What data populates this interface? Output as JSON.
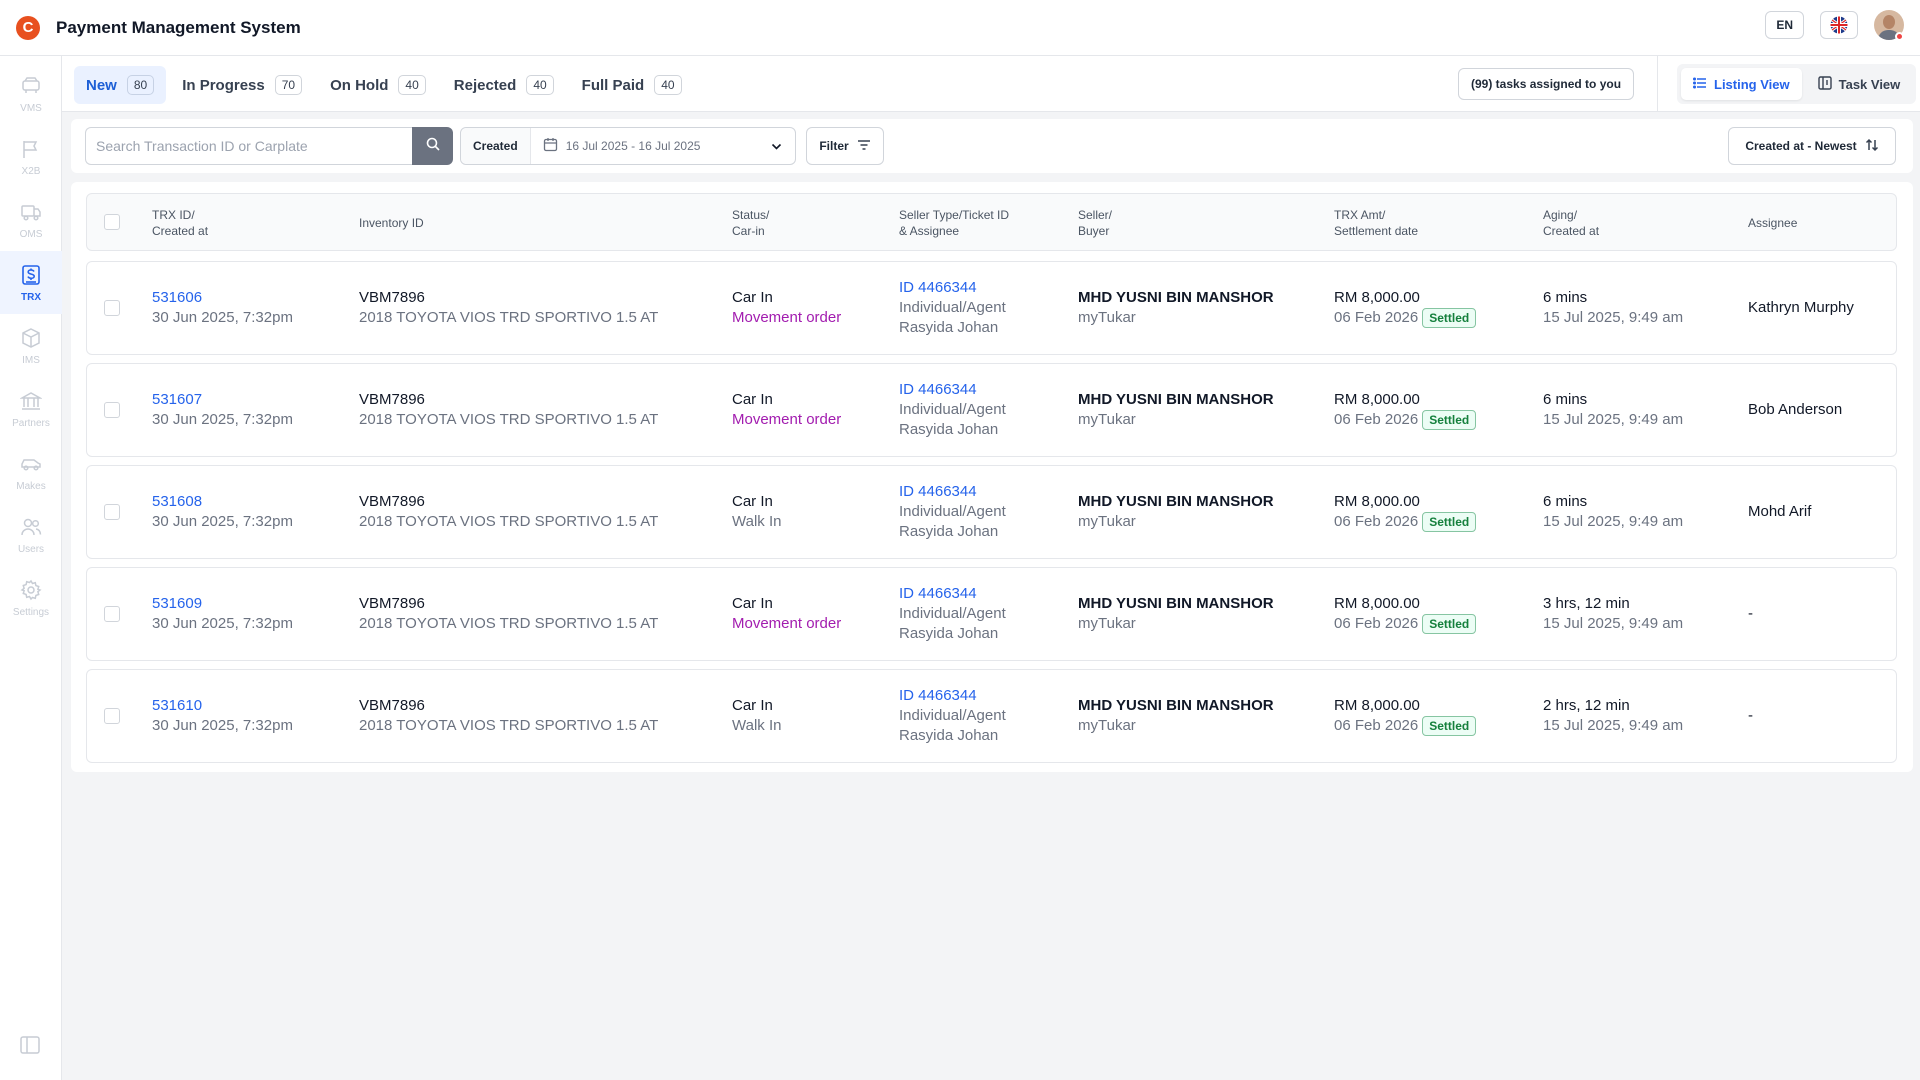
{
  "header": {
    "logo_letter": "C",
    "title": "Payment Management System",
    "lang": "EN"
  },
  "sidebar": {
    "items": [
      {
        "label": "VMS",
        "icon": "vms-icon"
      },
      {
        "label": "X2B",
        "icon": "flag-icon"
      },
      {
        "label": "OMS",
        "icon": "truck-icon"
      },
      {
        "label": "TRX",
        "icon": "dollar-document-icon",
        "active": true
      },
      {
        "label": "IMS",
        "icon": "box-icon"
      },
      {
        "label": "Partners",
        "icon": "bank-icon"
      },
      {
        "label": "Makes",
        "icon": "car-icon"
      },
      {
        "label": "Users",
        "icon": "users-icon"
      },
      {
        "label": "Settings",
        "icon": "gear-icon"
      }
    ]
  },
  "tabs": [
    {
      "label": "New",
      "count": "80",
      "active": true
    },
    {
      "label": "In Progress",
      "count": "70"
    },
    {
      "label": "On Hold",
      "count": "40"
    },
    {
      "label": "Rejected",
      "count": "40"
    },
    {
      "label": "Full Paid",
      "count": "40"
    }
  ],
  "tasks_badge": "(99) tasks assigned to you",
  "views": {
    "listing": "Listing View",
    "task": "Task View"
  },
  "search": {
    "placeholder": "Search Transaction ID or Carplate",
    "value": ""
  },
  "date_filter": {
    "label": "Created",
    "range": "16 Jul 2025 - 16 Jul 2025"
  },
  "filter_label": "Filter",
  "sort_label": "Created at - Newest",
  "table": {
    "headers": {
      "trx": [
        "TRX ID/",
        "Created at"
      ],
      "inventory": [
        "Inventory ID"
      ],
      "status": [
        "Status/",
        "Car-in"
      ],
      "seller_type": [
        "Seller Type/Ticket ID",
        "& Assignee"
      ],
      "seller": [
        "Seller/",
        "Buyer"
      ],
      "amount": [
        "TRX Amt/",
        "Settlement date"
      ],
      "aging": [
        "Aging/",
        "Created at"
      ],
      "assignee": [
        "Assignee"
      ]
    },
    "rows": [
      {
        "trx_id": "531606",
        "trx_created": "30 Jun 2025, 7:32pm",
        "inv_id": "VBM7896",
        "inv_desc": "2018 TOYOTA VIOS TRD SPORTIVO 1.5 AT",
        "status": "Car In",
        "car_in": "Movement order",
        "car_in_type": "movement",
        "ticket": "ID 4466344",
        "seller_type": "Individual/Agent",
        "ticket_assignee": "Rasyida Johan",
        "seller": "MHD YUSNI BIN MANSHOR",
        "buyer": "myTukar",
        "amount": "RM 8,000.00",
        "settle_date": "06 Feb 2026",
        "settle_status": "Settled",
        "aging": "6 mins",
        "aging_created": "15 Jul 2025, 9:49 am",
        "assignee": "Kathryn Murphy"
      },
      {
        "trx_id": "531607",
        "trx_created": "30 Jun 2025, 7:32pm",
        "inv_id": "VBM7896",
        "inv_desc": "2018 TOYOTA VIOS TRD SPORTIVO 1.5 AT",
        "status": "Car In",
        "car_in": "Movement order",
        "car_in_type": "movement",
        "ticket": "ID 4466344",
        "seller_type": "Individual/Agent",
        "ticket_assignee": "Rasyida Johan",
        "seller": "MHD YUSNI BIN MANSHOR",
        "buyer": "myTukar",
        "amount": "RM 8,000.00",
        "settle_date": "06 Feb 2026",
        "settle_status": "Settled",
        "aging": "6 mins",
        "aging_created": "15 Jul 2025, 9:49 am",
        "assignee": "Bob Anderson"
      },
      {
        "trx_id": "531608",
        "trx_created": "30 Jun 2025, 7:32pm",
        "inv_id": "VBM7896",
        "inv_desc": "2018 TOYOTA VIOS TRD SPORTIVO 1.5 AT",
        "status": "Car In",
        "car_in": "Walk In",
        "car_in_type": "walkin",
        "ticket": "ID 4466344",
        "seller_type": "Individual/Agent",
        "ticket_assignee": "Rasyida Johan",
        "seller": "MHD YUSNI BIN MANSHOR",
        "buyer": "myTukar",
        "amount": "RM 8,000.00",
        "settle_date": "06 Feb 2026",
        "settle_status": "Settled",
        "aging": "6 mins",
        "aging_created": "15 Jul 2025, 9:49 am",
        "assignee": "Mohd Arif"
      },
      {
        "trx_id": "531609",
        "trx_created": "30 Jun 2025, 7:32pm",
        "inv_id": "VBM7896",
        "inv_desc": "2018 TOYOTA VIOS TRD SPORTIVO 1.5 AT",
        "status": "Car In",
        "car_in": "Movement order",
        "car_in_type": "movement",
        "ticket": "ID 4466344",
        "seller_type": "Individual/Agent",
        "ticket_assignee": "Rasyida Johan",
        "seller": "MHD YUSNI BIN MANSHOR",
        "buyer": "myTukar",
        "amount": "RM 8,000.00",
        "settle_date": "06 Feb 2026",
        "settle_status": "Settled",
        "aging": "3 hrs, 12 min",
        "aging_created": "15 Jul 2025, 9:49 am",
        "assignee": "-"
      },
      {
        "trx_id": "531610",
        "trx_created": "30 Jun 2025, 7:32pm",
        "inv_id": "VBM7896",
        "inv_desc": "2018 TOYOTA VIOS TRD SPORTIVO 1.5 AT",
        "status": "Car In",
        "car_in": "Walk In",
        "car_in_type": "walkin",
        "ticket": "ID 4466344",
        "seller_type": "Individual/Agent",
        "ticket_assignee": "Rasyida Johan",
        "seller": "MHD YUSNI BIN MANSHOR",
        "buyer": "myTukar",
        "amount": "RM 8,000.00",
        "settle_date": "06 Feb 2026",
        "settle_status": "Settled",
        "aging": "2 hrs, 12 min",
        "aging_created": "15 Jul 2025, 9:49 am",
        "assignee": "-"
      }
    ]
  },
  "colors": {
    "brand": "#e8501f",
    "accent": "#2563eb",
    "movement": "#a21caf",
    "settled": "#15803d"
  }
}
